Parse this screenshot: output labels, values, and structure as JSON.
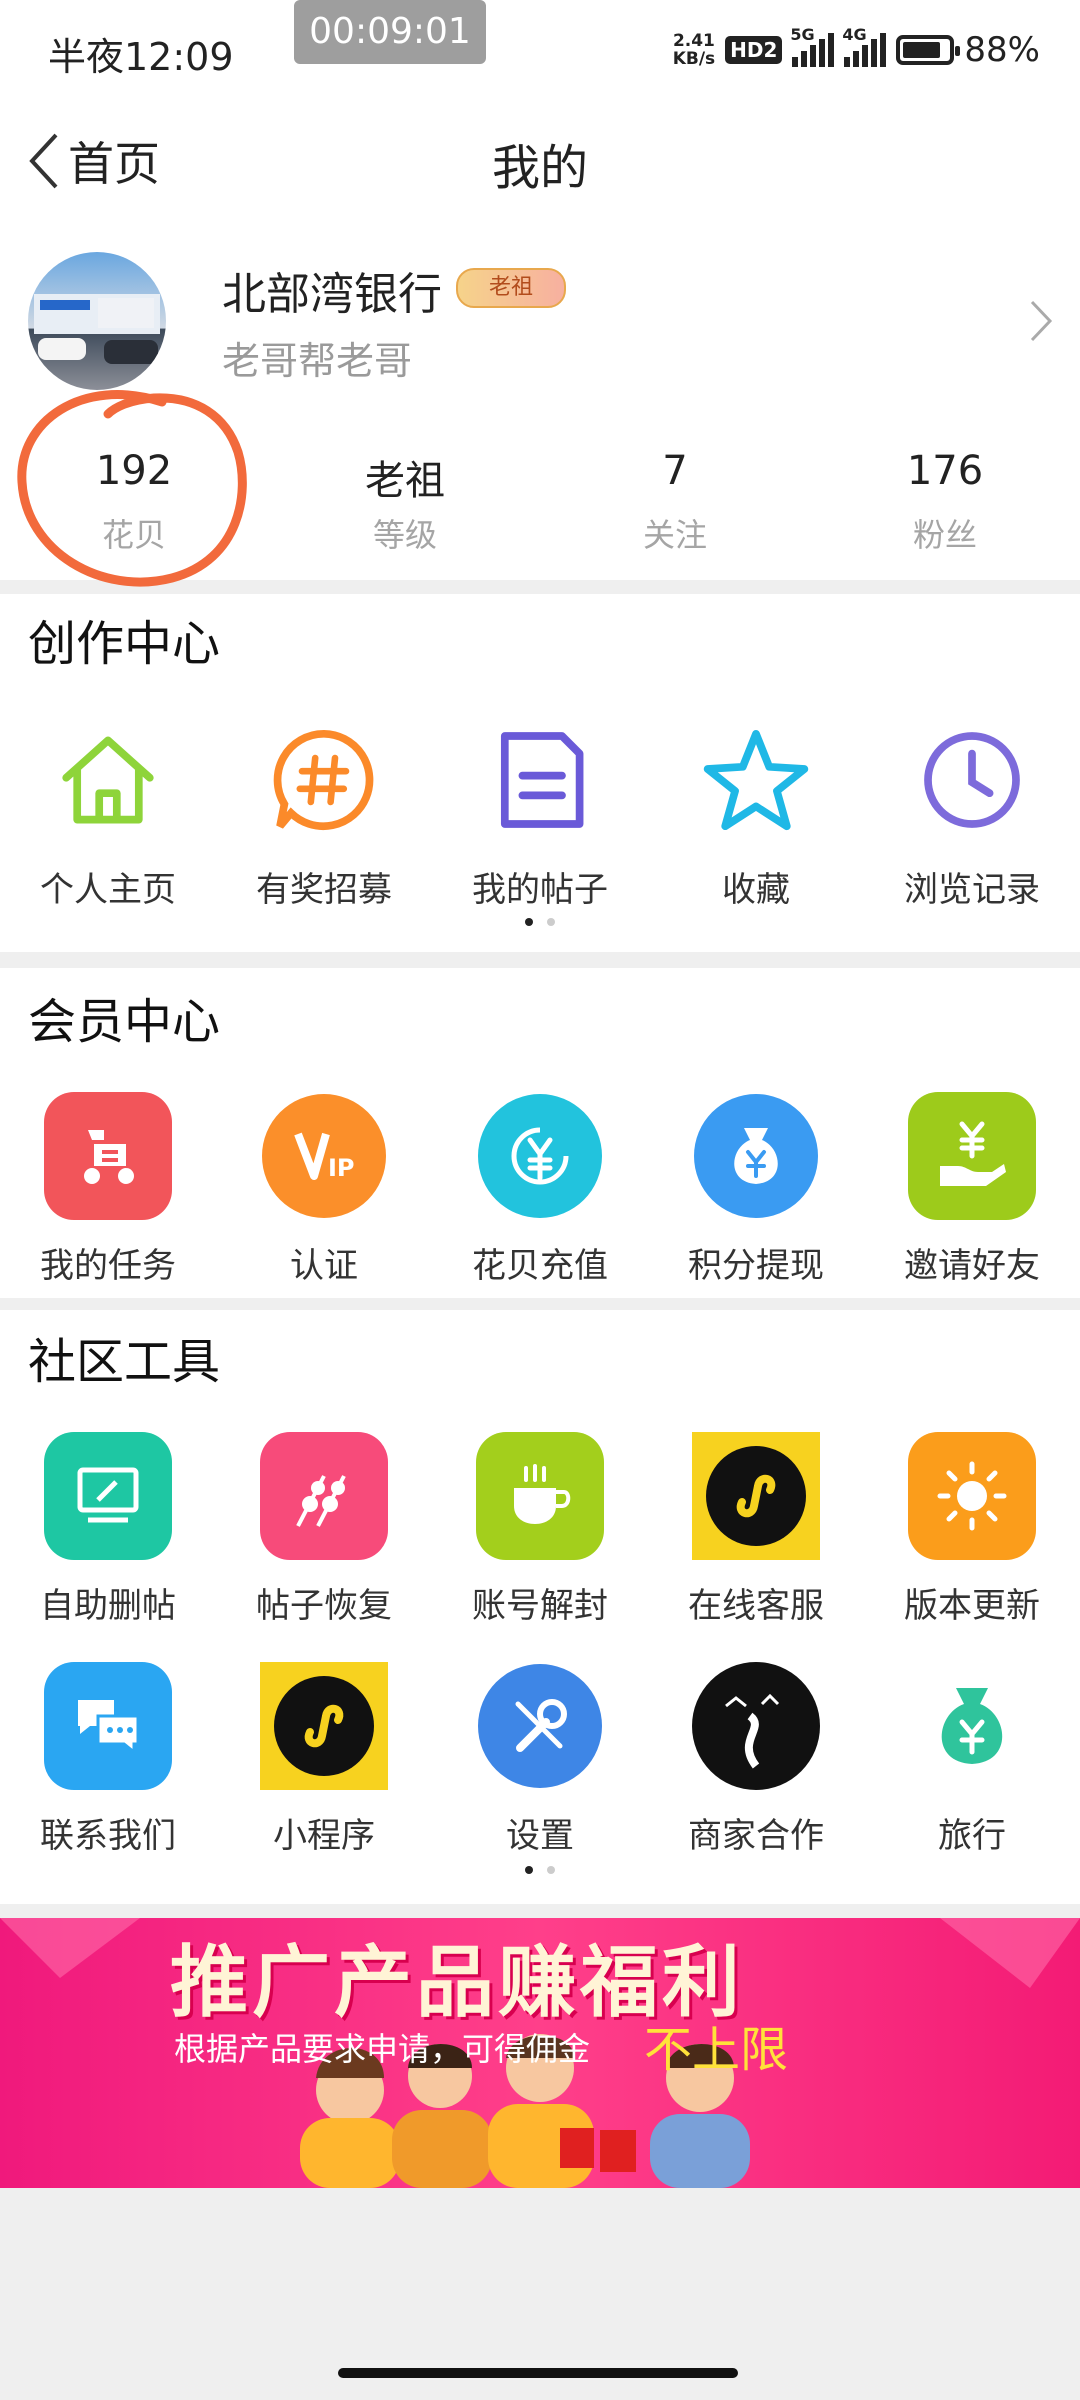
{
  "status": {
    "time": "半夜12:09",
    "timer": "00:09:01",
    "speed_top": "2.41",
    "speed_bottom": "KB/s",
    "hd": "HD2",
    "net1": "5G",
    "net2": "4G",
    "battery_percent": "88%",
    "battery_level": 0.88
  },
  "nav": {
    "back_label": "首页",
    "title": "我的"
  },
  "profile": {
    "name": "北部湾银行",
    "badge": "老祖",
    "signature": "老哥帮老哥"
  },
  "stats": [
    {
      "value": "192",
      "label": "花贝"
    },
    {
      "value": "老祖",
      "label": "等级"
    },
    {
      "value": "7",
      "label": "关注"
    },
    {
      "value": "176",
      "label": "粉丝"
    }
  ],
  "creation": {
    "title": "创作中心",
    "items": [
      {
        "label": "个人主页",
        "icon": "home-icon"
      },
      {
        "label": "有奖招募",
        "icon": "hashtag-chat-icon"
      },
      {
        "label": "我的帖子",
        "icon": "document-icon"
      },
      {
        "label": "收藏",
        "icon": "star-icon"
      },
      {
        "label": "浏览记录",
        "icon": "clock-icon"
      }
    ]
  },
  "member": {
    "title": "会员中心",
    "items": [
      {
        "label": "我的任务",
        "icon": "scooter-icon",
        "color": "#f2555a"
      },
      {
        "label": "认证",
        "icon": "vip-icon",
        "color": "#fb8f2a"
      },
      {
        "label": "花贝充值",
        "icon": "yuan-refresh-icon",
        "color": "#22c3dd"
      },
      {
        "label": "积分提现",
        "icon": "money-bag-icon",
        "color": "#3a9bf2"
      },
      {
        "label": "邀请好友",
        "icon": "hand-yuan-icon",
        "color": "#9dcb1b"
      }
    ]
  },
  "tools": {
    "title": "社区工具",
    "items": [
      {
        "label": "自助删帖",
        "icon": "monitor-edit-icon",
        "color": "#1ec7a3"
      },
      {
        "label": "帖子恢复",
        "icon": "skewer-icon",
        "color": "#f74b7a"
      },
      {
        "label": "账号解封",
        "icon": "cup-icon",
        "color": "#a3cf1c"
      },
      {
        "label": "在线客服",
        "icon": "mini-program-icon",
        "color": "#f7d21f"
      },
      {
        "label": "版本更新",
        "icon": "sun-icon",
        "color": "#fb9d1b"
      },
      {
        "label": "联系我们",
        "icon": "chat-bubbles-icon",
        "color": "#2aa6f2"
      },
      {
        "label": "小程序",
        "icon": "mini-program-icon",
        "color": "#f7d21f"
      },
      {
        "label": "设置",
        "icon": "wrench-icon",
        "color": "#3e86e6"
      },
      {
        "label": "商家合作",
        "icon": "road-icon",
        "color": "#111111"
      },
      {
        "label": "旅行",
        "icon": "money-bag-icon",
        "color": "#2fc49c"
      }
    ]
  },
  "banner": {
    "title": "推广产品赚福利",
    "subtitle": "根据产品要求申请，可得佣金",
    "highlight": "不上限"
  }
}
